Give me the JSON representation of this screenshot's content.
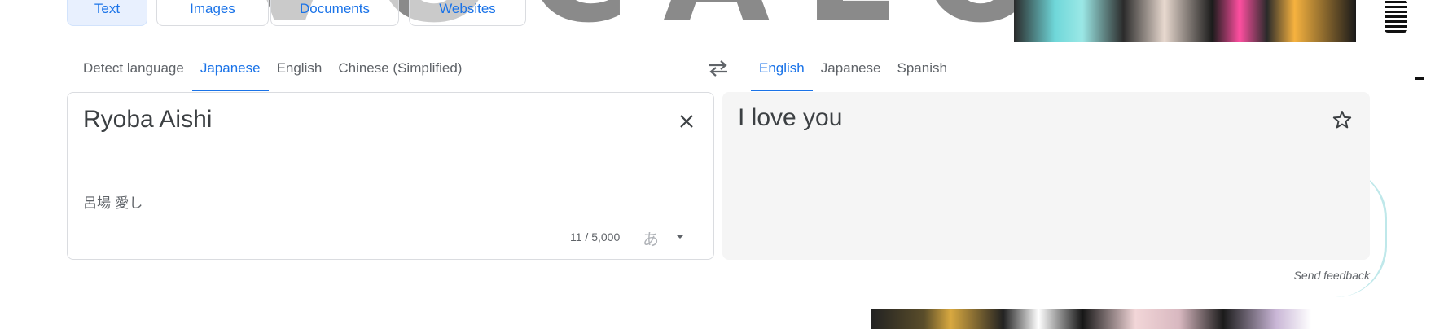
{
  "mode_tabs": [
    {
      "label": "Text",
      "active": true
    },
    {
      "label": "Images",
      "active": false
    },
    {
      "label": "Documents",
      "active": false
    },
    {
      "label": "Websites",
      "active": false
    }
  ],
  "source_languages": [
    {
      "label": "Detect language",
      "active": false
    },
    {
      "label": "Japanese",
      "active": true
    },
    {
      "label": "English",
      "active": false
    },
    {
      "label": "Chinese (Simplified)",
      "active": false
    }
  ],
  "target_languages": [
    {
      "label": "English",
      "active": true
    },
    {
      "label": "Japanese",
      "active": false
    },
    {
      "label": "Spanish",
      "active": false
    }
  ],
  "source": {
    "text": "Ryoba Aishi",
    "transliteration": "呂場 愛し",
    "char_count": "11 / 5,000",
    "ime_glyph": "あ",
    "clear_icon": "close-icon"
  },
  "target": {
    "text": "I love you",
    "star_icon": "star-outline-icon"
  },
  "swap_icon": "swap-horiz-icon",
  "feedback_label": "Send feedback",
  "background": {
    "logo_text": "VOCALOID"
  },
  "colors": {
    "accent": "#1a73e8",
    "active_tab_bg": "#e8f0fe",
    "target_panel_bg": "#f5f5f5",
    "border": "#dadce0",
    "text": "#3c4043",
    "muted": "#5f6368"
  }
}
